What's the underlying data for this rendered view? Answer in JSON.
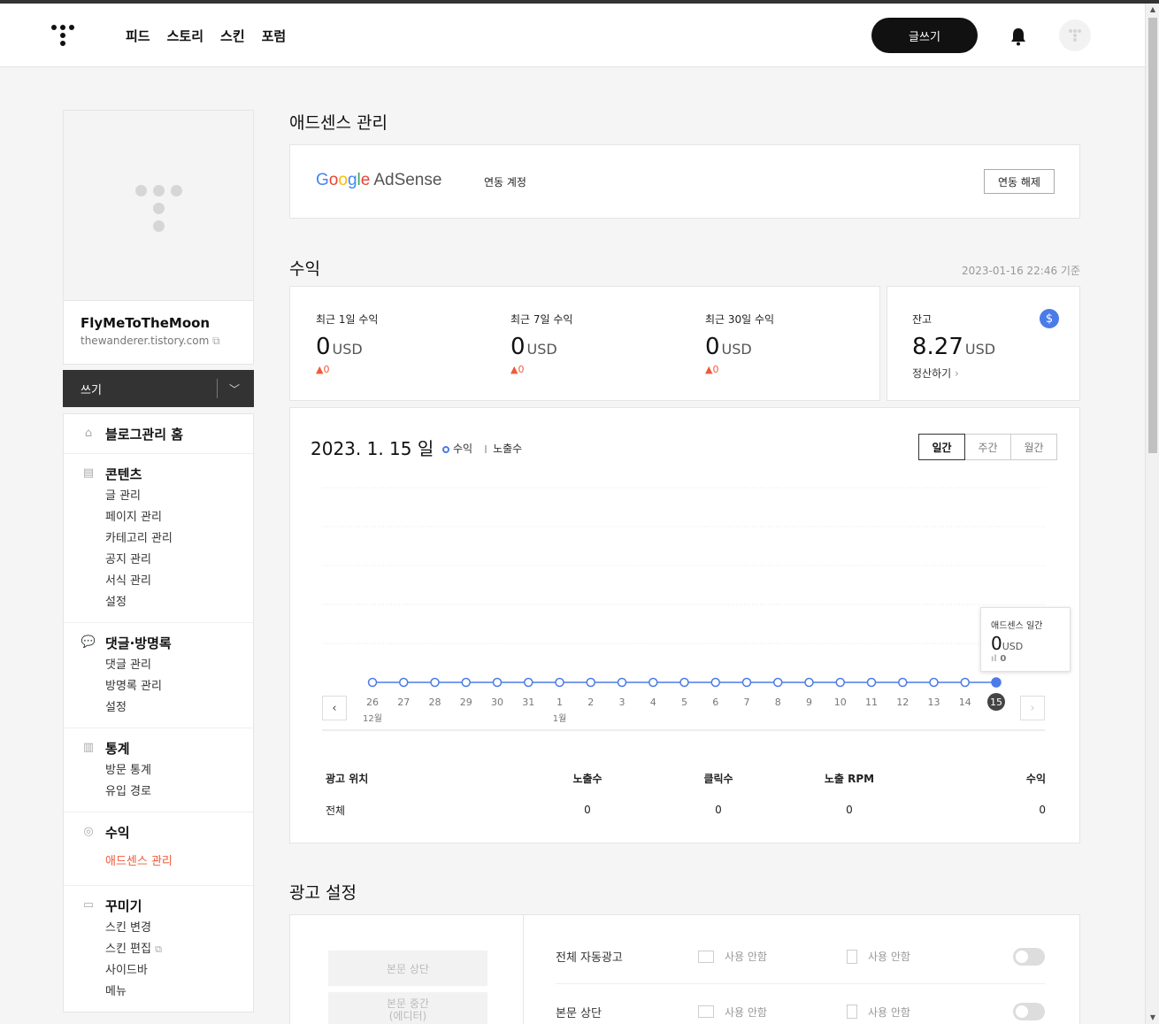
{
  "header": {
    "nav": [
      "피드",
      "스토리",
      "스킨",
      "포럼"
    ],
    "write_label": "글쓰기"
  },
  "sidebar": {
    "blog_name": "FlyMeToTheMoon",
    "blog_url": "thewanderer.tistory.com",
    "write_label": "쓰기",
    "sections": [
      {
        "title": "블로그관리 홈",
        "icon": "home-icon",
        "items": []
      },
      {
        "title": "콘텐츠",
        "icon": "document-icon",
        "items": [
          "글 관리",
          "페이지 관리",
          "카테고리 관리",
          "공지 관리",
          "서식 관리",
          "설정"
        ]
      },
      {
        "title": "댓글·방명록",
        "icon": "comment-icon",
        "items": [
          "댓글 관리",
          "방명록 관리",
          "설정"
        ]
      },
      {
        "title": "통계",
        "icon": "bar-chart-icon",
        "items": [
          "방문 통계",
          "유입 경로"
        ]
      },
      {
        "title": "수익",
        "icon": "coins-icon",
        "items": [
          "애드센스 관리"
        ],
        "active": "애드센스 관리"
      },
      {
        "title": "꾸미기",
        "icon": "layout-icon",
        "items": [
          "스킨 변경",
          "스킨 편집",
          "사이드바",
          "메뉴"
        ]
      }
    ]
  },
  "adsense": {
    "title": "애드센스 관리",
    "logo_google": [
      "G",
      "o",
      "o",
      "g",
      "l",
      "e"
    ],
    "logo_adsense": "AdSense",
    "linked_label": "연동 계정",
    "unlink_label": "연동 해제"
  },
  "revenue": {
    "title": "수익",
    "timestamp": "2023-01-16 22:46 기준",
    "stats": [
      {
        "label": "최근 1일 수익",
        "value": "0",
        "unit": "USD",
        "change": "▲0"
      },
      {
        "label": "최근 7일 수익",
        "value": "0",
        "unit": "USD",
        "change": "▲0"
      },
      {
        "label": "최근 30일 수익",
        "value": "0",
        "unit": "USD",
        "change": "▲0"
      }
    ],
    "balance": {
      "label": "잔고",
      "value": "8.27",
      "unit": "USD",
      "settle": "정산하기",
      "dollar": "$"
    }
  },
  "chart": {
    "date_num": "2023. 1. 15",
    "date_day": "일",
    "legend_revenue": "수익",
    "legend_impressions": "노출수",
    "periods": [
      "일간",
      "주간",
      "월간"
    ],
    "active_period": "일간",
    "tooltip": {
      "title": "애드센스 일간",
      "value": "0",
      "unit": "USD",
      "impressions": "0"
    }
  },
  "chart_data": {
    "type": "line",
    "x": [
      "26",
      "27",
      "28",
      "29",
      "30",
      "31",
      "1",
      "2",
      "3",
      "4",
      "5",
      "6",
      "7",
      "8",
      "9",
      "10",
      "11",
      "12",
      "13",
      "14",
      "15"
    ],
    "month_labels": [
      {
        "at": "26",
        "label": "12월"
      },
      {
        "at": "1",
        "label": "1월"
      }
    ],
    "series": [
      {
        "name": "수익",
        "values": [
          0,
          0,
          0,
          0,
          0,
          0,
          0,
          0,
          0,
          0,
          0,
          0,
          0,
          0,
          0,
          0,
          0,
          0,
          0,
          0,
          0
        ]
      }
    ],
    "highlight": "15",
    "grid": true
  },
  "table": {
    "headers": [
      "광고 위치",
      "노출수",
      "클릭수",
      "노출 RPM",
      "수익"
    ],
    "rows": [
      [
        "전체",
        "0",
        "0",
        "0",
        "0"
      ]
    ]
  },
  "ad_settings": {
    "title": "광고 설정",
    "slots": [
      "본문 상단",
      "본문 중간\n(에디터)"
    ],
    "rows": [
      {
        "label": "전체 자동광고",
        "opt1": "사용 안함",
        "opt2": "사용 안함"
      },
      {
        "label": "본문 상단",
        "opt1": "사용 안함",
        "opt2": "사용 안함"
      }
    ]
  }
}
